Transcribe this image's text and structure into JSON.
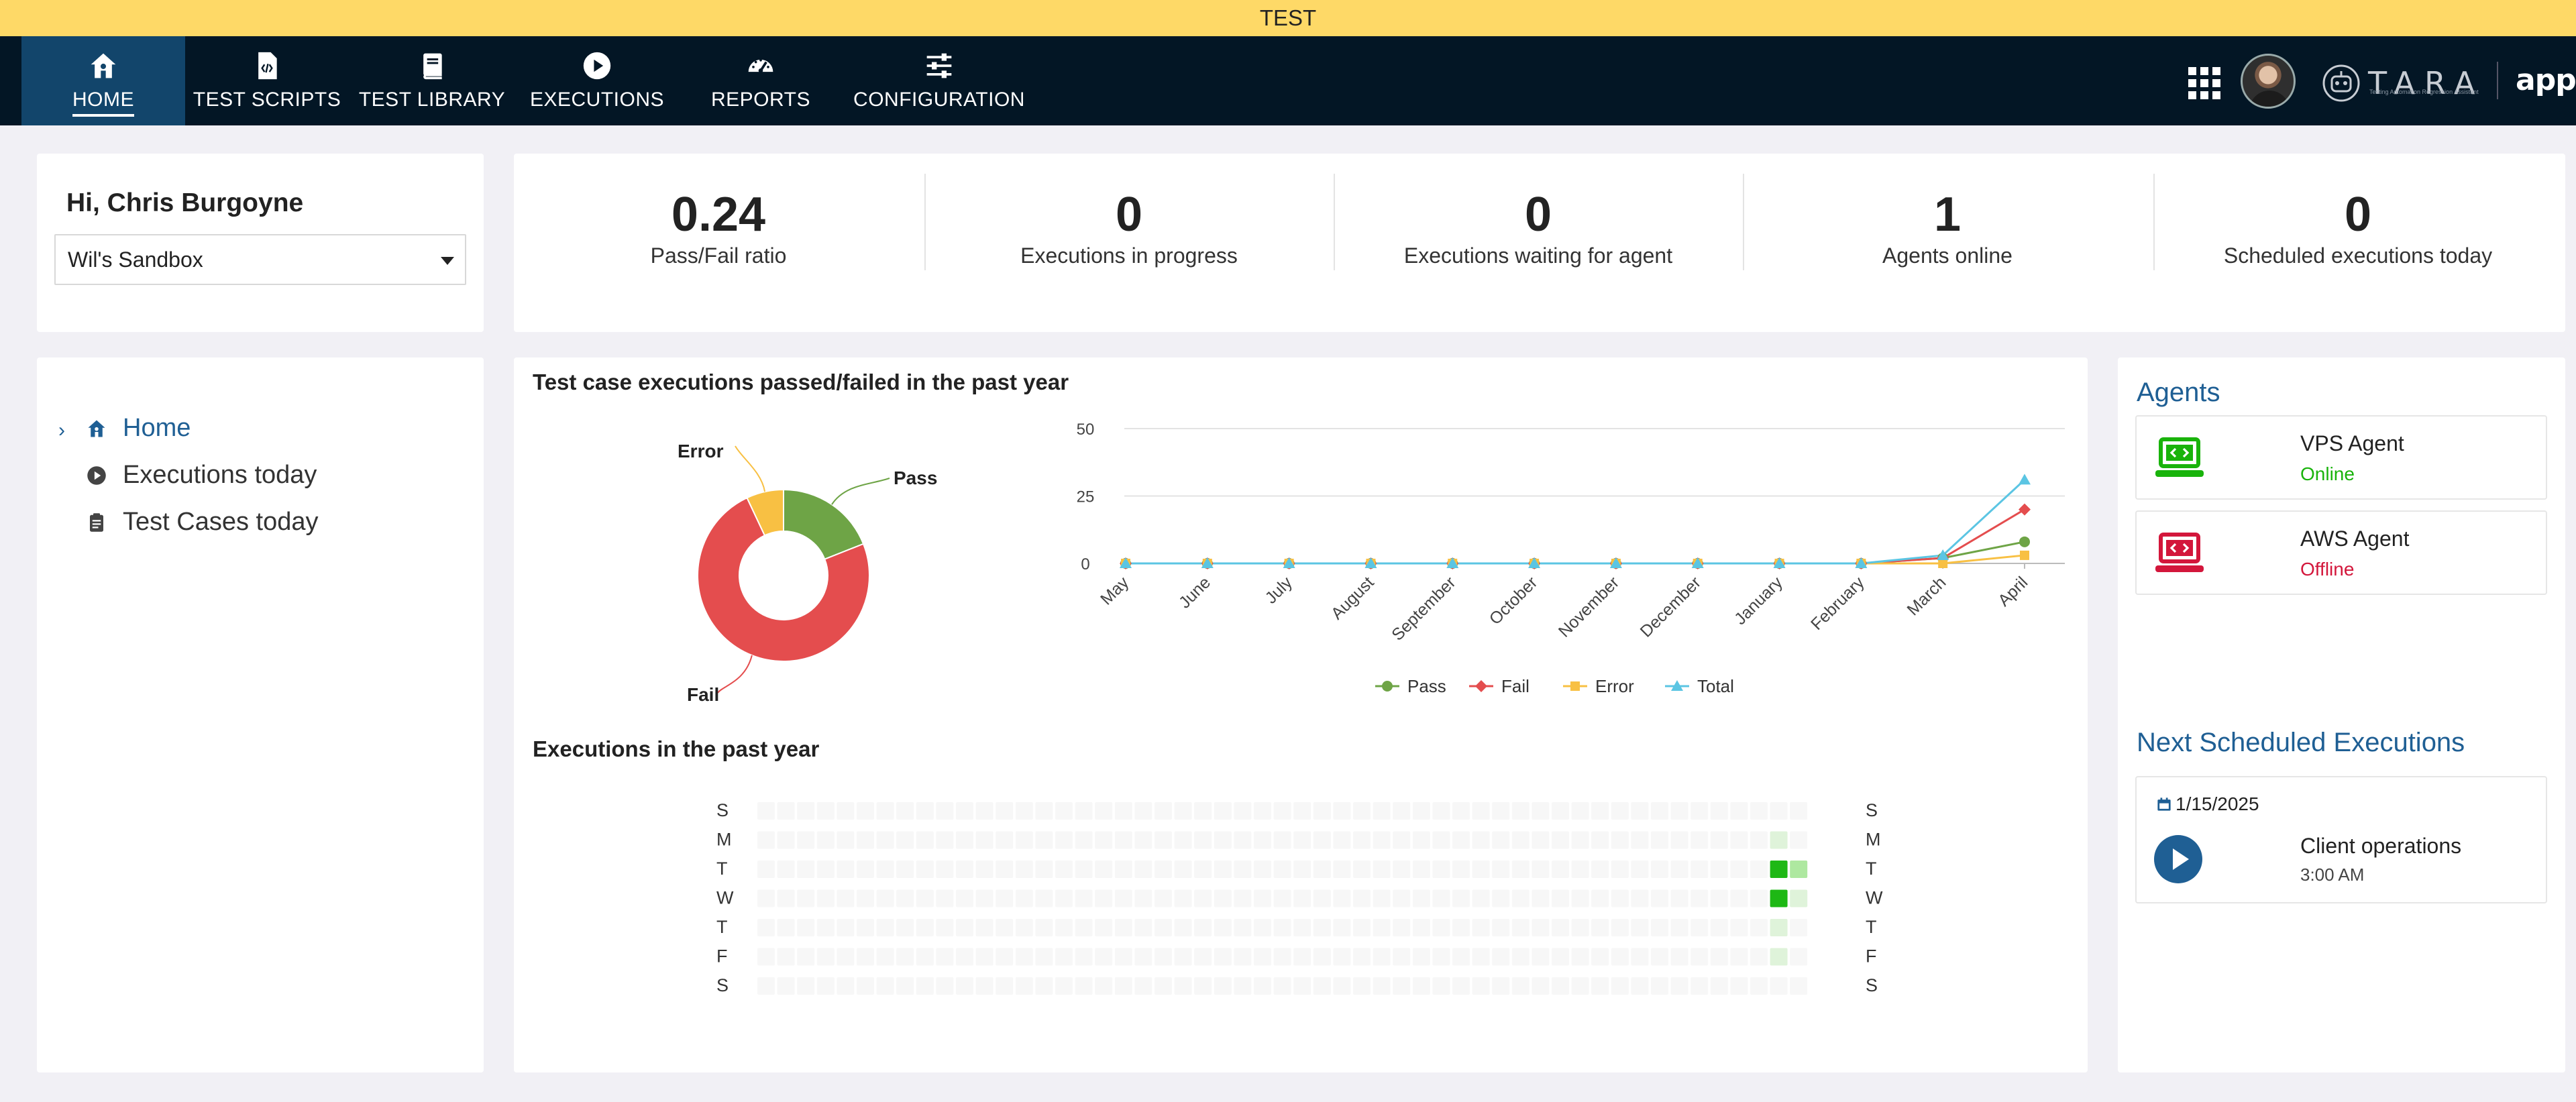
{
  "env_banner": "TEST",
  "nav": {
    "items": [
      {
        "label": "HOME",
        "icon": "home-icon",
        "active": true
      },
      {
        "label": "TEST SCRIPTS",
        "icon": "script-file-icon"
      },
      {
        "label": "TEST LIBRARY",
        "icon": "book-icon"
      },
      {
        "label": "EXECUTIONS",
        "icon": "play-circle-icon"
      },
      {
        "label": "REPORTS",
        "icon": "gauge-icon"
      },
      {
        "label": "CONFIGURATION",
        "icon": "sliders-icon"
      }
    ],
    "tara_logo": "TARA",
    "tara_tagline": "Testing Automation Regression Assistant",
    "appian_logo": "appian"
  },
  "greeting": {
    "text": "Hi, Chris Burgoyne",
    "workspace": "Wil's Sandbox"
  },
  "stats": [
    {
      "value": "0.24",
      "label": "Pass/Fail ratio"
    },
    {
      "value": "0",
      "label": "Executions in progress"
    },
    {
      "value": "0",
      "label": "Executions waiting for agent"
    },
    {
      "value": "1",
      "label": "Agents online"
    },
    {
      "value": "0",
      "label": "Scheduled executions today"
    }
  ],
  "sidebar": {
    "items": [
      {
        "label": "Home",
        "icon": "home-icon",
        "active": true
      },
      {
        "label": "Executions today",
        "icon": "play-circle-icon"
      },
      {
        "label": "Test Cases today",
        "icon": "clipboard-icon"
      }
    ]
  },
  "main": {
    "passfail_title": "Test case executions passed/failed in the past year",
    "calendar_title": "Executions in the past year"
  },
  "chart_data": [
    {
      "type": "pie",
      "variant": "donut",
      "labels": [
        "Pass",
        "Fail",
        "Error"
      ],
      "values": [
        19,
        74,
        7
      ],
      "colors": [
        "#6ea446",
        "#e44d4e",
        "#f8c043"
      ]
    },
    {
      "type": "line",
      "categories": [
        "May",
        "June",
        "July",
        "August",
        "September",
        "October",
        "November",
        "December",
        "January",
        "February",
        "March",
        "April"
      ],
      "ylim": [
        0,
        50
      ],
      "yticks": [
        0,
        25,
        50
      ],
      "grid": true,
      "legend": "bottom",
      "series": [
        {
          "name": "Pass",
          "color": "#6ea446",
          "marker": "circle",
          "values": [
            0,
            0,
            0,
            0,
            0,
            0,
            0,
            0,
            0,
            0,
            2,
            8
          ]
        },
        {
          "name": "Fail",
          "color": "#e44d4e",
          "marker": "diamond",
          "values": [
            0,
            0,
            0,
            0,
            0,
            0,
            0,
            0,
            0,
            0,
            2,
            20
          ]
        },
        {
          "name": "Error",
          "color": "#f8c043",
          "marker": "square",
          "values": [
            0,
            0,
            0,
            0,
            0,
            0,
            0,
            0,
            0,
            0,
            0,
            3
          ]
        },
        {
          "name": "Total",
          "color": "#5bc5e3",
          "marker": "triangle",
          "values": [
            0,
            0,
            0,
            0,
            0,
            0,
            0,
            0,
            0,
            0,
            3,
            31
          ]
        }
      ]
    },
    {
      "type": "heatmap",
      "rows": [
        "S",
        "M",
        "T",
        "W",
        "T",
        "F",
        "S"
      ],
      "weeks": 53,
      "empty_color": "#f7f7f7",
      "scale_colors": [
        "#dff3da",
        "#aee8a0",
        "#1eb815"
      ],
      "cells": [
        {
          "week": 51,
          "day": 1,
          "level": 1
        },
        {
          "week": 51,
          "day": 2,
          "level": 3
        },
        {
          "week": 52,
          "day": 2,
          "level": 2
        },
        {
          "week": 51,
          "day": 3,
          "level": 3
        },
        {
          "week": 52,
          "day": 3,
          "level": 1
        },
        {
          "week": 51,
          "day": 4,
          "level": 1
        },
        {
          "week": 51,
          "day": 5,
          "level": 1
        }
      ]
    }
  ],
  "agents": {
    "title": "Agents",
    "items": [
      {
        "name": "VPS Agent",
        "status": "Online",
        "status_color": "#19b30b",
        "icon_color": "#19b30b"
      },
      {
        "name": "AWS Agent",
        "status": "Offline",
        "status_color": "#d3163b",
        "icon_color": "#d3163b"
      }
    ]
  },
  "next_scheduled": {
    "title": "Next Scheduled Executions",
    "items": [
      {
        "date": "1/15/2025",
        "name": "Client operations",
        "time": "3:00 AM"
      }
    ]
  }
}
